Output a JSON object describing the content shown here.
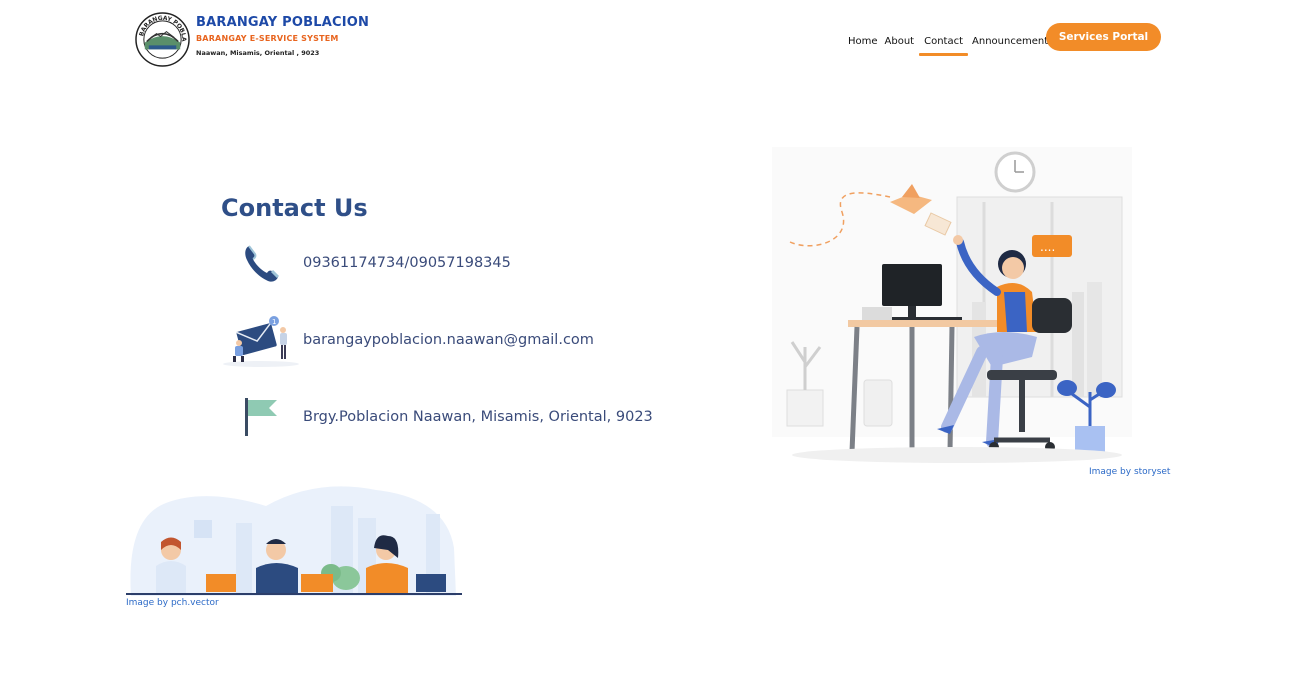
{
  "header": {
    "brand_title": "BARANGAY POBLACION",
    "brand_subtitle": "BARANGAY E-SERVICE SYSTEM",
    "brand_address": "Naawan, Misamis, Oriental , 9023",
    "seal_text": "BARANGAY POBLACION",
    "nav": [
      {
        "label": "Home"
      },
      {
        "label": "About"
      },
      {
        "label": "Contact"
      },
      {
        "label": "Announcement"
      }
    ],
    "active_nav": "Contact",
    "portal_label": "Services Portal"
  },
  "contact": {
    "title": "Contact Us",
    "phone": "09361174734/09057198345",
    "email": "barangaypoblacion.naawan@gmail.com",
    "address": "Brgy.Poblacion Naawan, Misamis, Oriental, 9023"
  },
  "credits": {
    "storyset": "Image by storyset",
    "pch": "Image by pch.vector"
  },
  "colors": {
    "brand_blue": "#1d49a7",
    "accent_orange": "#f28c28",
    "text_blue": "#2f4f88"
  },
  "icons": {
    "phone": "phone-icon",
    "email": "email-icon",
    "address": "flag-icon"
  }
}
